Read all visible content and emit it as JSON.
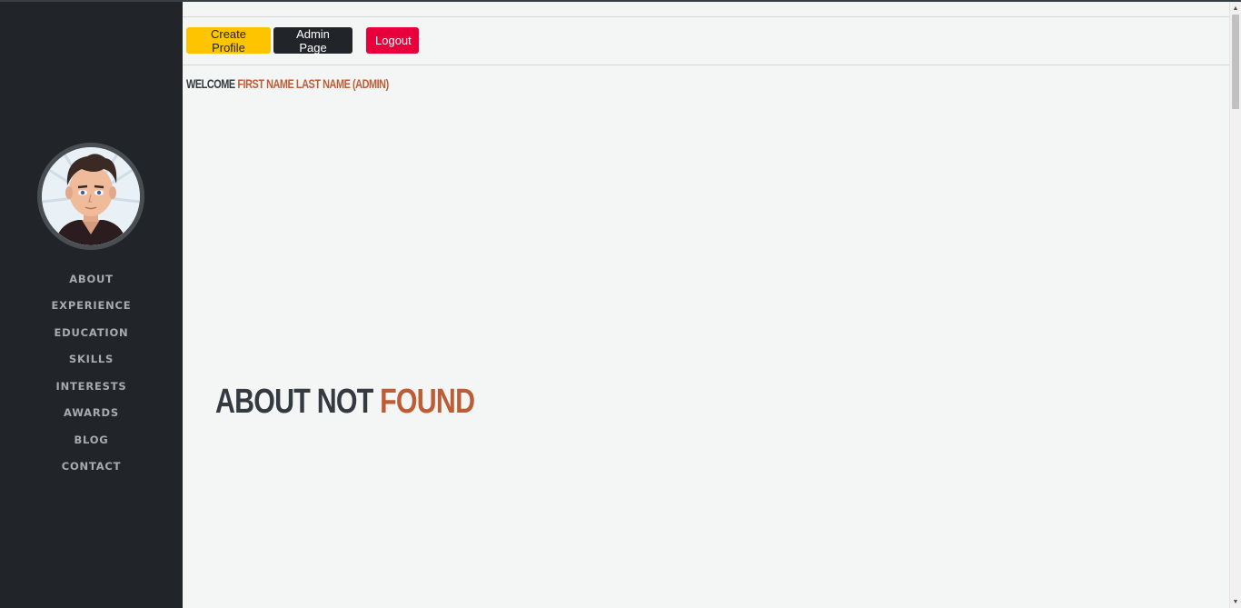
{
  "toolbar": {
    "create_profile_label": "Create Profile",
    "admin_page_label": "Admin Page",
    "logout_label": "Logout"
  },
  "welcome": {
    "prefix": "WELCOME",
    "user": "FIRST NAME LAST NAME (ADMIN)"
  },
  "sidebar": {
    "avatar_icon": "profile-avatar-icon",
    "items": [
      {
        "label": "ABOUT"
      },
      {
        "label": "EXPERIENCE"
      },
      {
        "label": "EDUCATION"
      },
      {
        "label": "SKILLS"
      },
      {
        "label": "INTERESTS"
      },
      {
        "label": "AWARDS"
      },
      {
        "label": "BLOG"
      },
      {
        "label": "CONTACT"
      }
    ]
  },
  "main": {
    "heading_dark": "ABOUT NOT",
    "heading_accent": "FOUND"
  },
  "colors": {
    "sidebar_bg": "#212529",
    "accent": "#bd5d38",
    "create_button": "#ffc400",
    "admin_button": "#212529",
    "logout_button": "#e8003d"
  }
}
